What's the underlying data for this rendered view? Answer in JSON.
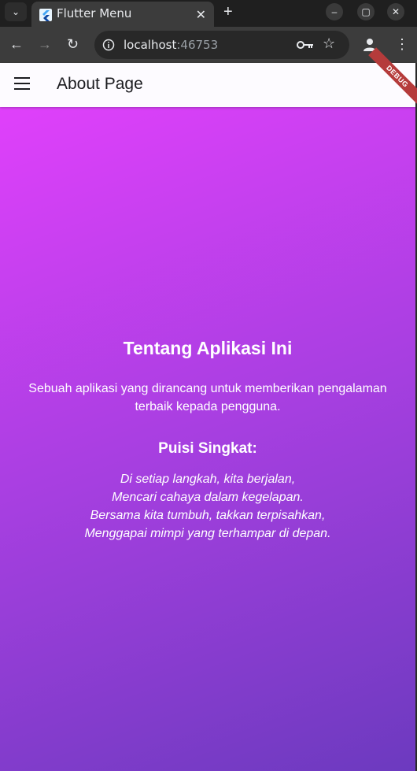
{
  "browser": {
    "tab_title": "Flutter Menu",
    "url_host": "localhost",
    "url_port": ":46753",
    "tab_close": "✕",
    "new_tab": "+",
    "tab_scroll": "⌄"
  },
  "app": {
    "title": "About Page",
    "debug_label": "DEBUG",
    "heading": "Tentang Aplikasi Ini",
    "description": "Sebuah aplikasi yang dirancang untuk memberikan pengalaman terbaik kepada pengguna.",
    "poem_heading": "Puisi Singkat:",
    "poem_lines": [
      "Di setiap langkah, kita berjalan,",
      "Mencari cahaya dalam kegelapan.",
      "Bersama kita tumbuh, takkan terpisahkan,",
      "Menggapai mimpi yang terhampar di depan."
    ],
    "gradient_colors": [
      "#e040fb",
      "#6c3abf"
    ]
  }
}
